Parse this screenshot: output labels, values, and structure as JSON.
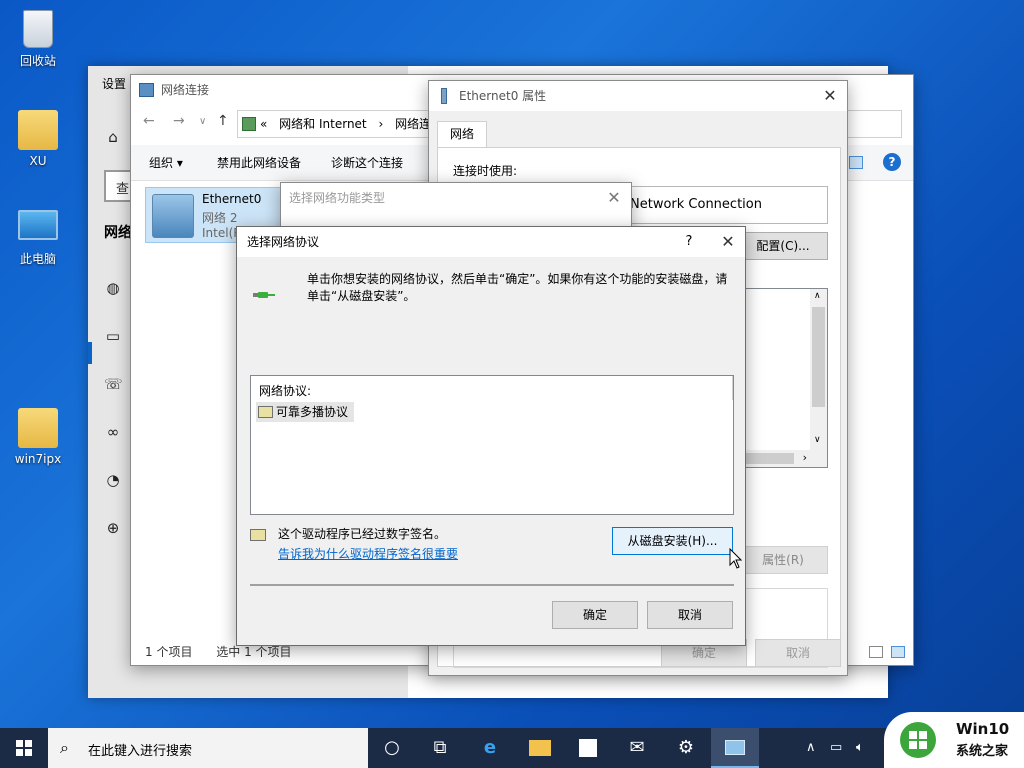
{
  "desktop": {
    "icons": [
      {
        "label": "回收站"
      },
      {
        "label": "XU"
      },
      {
        "label": "此电脑"
      },
      {
        "label": "win7ipx"
      }
    ]
  },
  "settings": {
    "title": "设置",
    "search_text": "查",
    "heading": "网络"
  },
  "network_connections": {
    "title": "网络连接",
    "breadcrumb": {
      "prefix": "«",
      "item1": "网络和 Internet",
      "sep": "›",
      "item2": "网络连接"
    },
    "commands": {
      "organize": "组织 ▾",
      "disable": "禁用此网络设备",
      "diagnose": "诊断这个连接"
    },
    "adapter": {
      "name": "Ethernet0",
      "network": "网络 2",
      "device": "Intel(R"
    },
    "status": {
      "count": "1 个项目",
      "selected": "选中 1 个项目"
    }
  },
  "ethernet_properties": {
    "title": "Ethernet0 属性",
    "tab": "网络",
    "connect_using_label": "连接时使用:",
    "adapter_text": "Network Connection",
    "configure_button": "配置(C)...",
    "properties_button": "属性(R)",
    "ok_button": "确定",
    "cancel_button": "取消"
  },
  "feature_type_dialog": {
    "title": "选择网络功能类型"
  },
  "protocol_dialog": {
    "title": "选择网络协议",
    "help": "?",
    "close": "✕",
    "instruction": "单击你想安装的网络协议，然后单击“确定”。如果你有这个功能的安装磁盘，请单击“从磁盘安装”。",
    "list_header": "网络协议:",
    "list_items": [
      "可靠多播协议"
    ],
    "signed_text": "这个驱动程序已经过数字签名。",
    "signing_link": "告诉我为什么驱动程序签名很重要",
    "have_disk_button": "从磁盘安装(H)...",
    "ok_button": "确定",
    "cancel_button": "取消"
  },
  "taskbar": {
    "search_placeholder": "在此键入进行搜索"
  },
  "watermark": {
    "line1": "Win10",
    "line2": "系统之家"
  },
  "colors": {
    "accent": "#0078d7",
    "link": "#0066cc",
    "taskbar": "#1b2b46"
  }
}
